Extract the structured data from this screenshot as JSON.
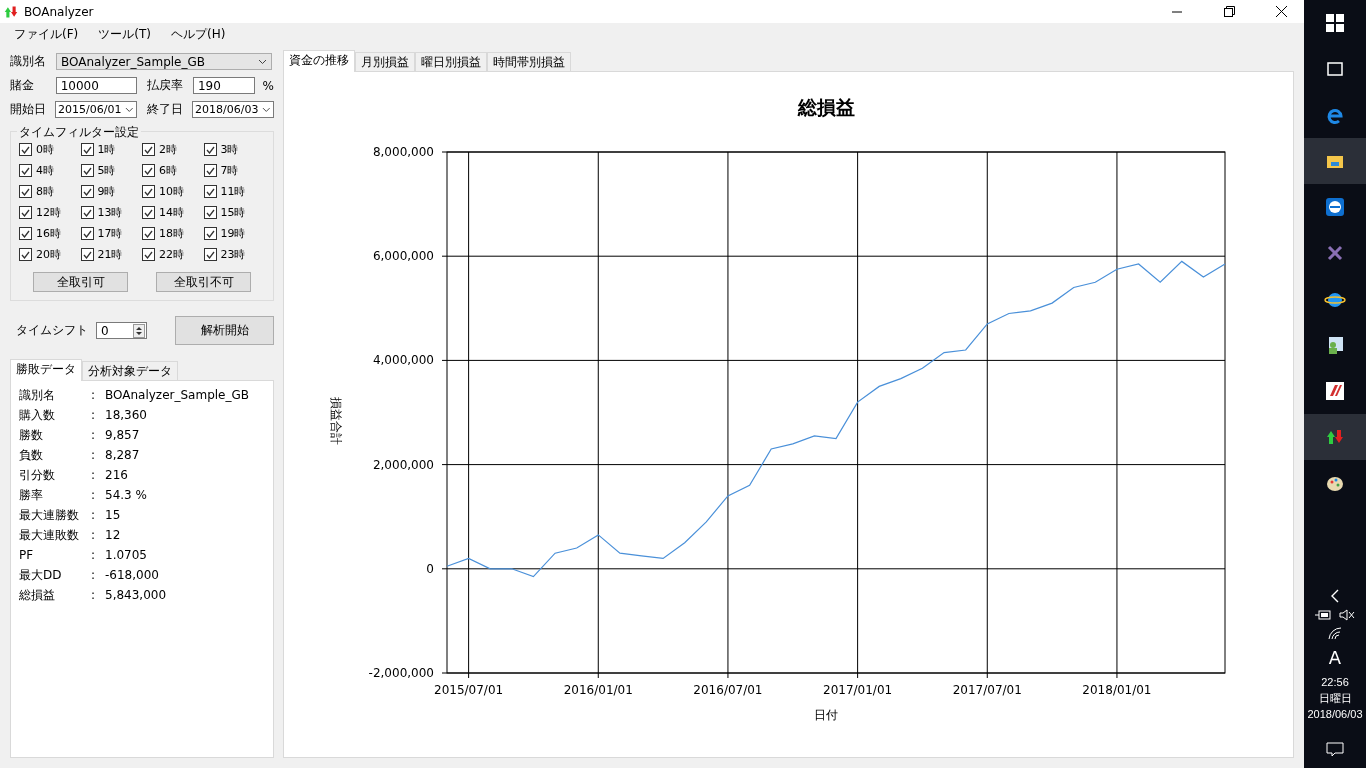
{
  "window": {
    "title": "BOAnalyzer"
  },
  "menu": [
    "ファイル(F)",
    "ツール(T)",
    "ヘルプ(H)"
  ],
  "settings": {
    "id_label": "識別名",
    "id_value": "BOAnalyzer_Sample_GB",
    "stake_label": "賭金",
    "stake_value": "10000",
    "payout_label": "払戻率",
    "payout_value": "190",
    "payout_unit": "%",
    "start_label": "開始日",
    "start_value": "2015/06/01",
    "end_label": "終了日",
    "end_value": "2018/06/03"
  },
  "time_filter": {
    "title": "タイムフィルター設定",
    "hours": [
      {
        "label": "0時",
        "checked": true
      },
      {
        "label": "1時",
        "checked": true
      },
      {
        "label": "2時",
        "checked": true
      },
      {
        "label": "3時",
        "checked": true
      },
      {
        "label": "4時",
        "checked": true
      },
      {
        "label": "5時",
        "checked": true
      },
      {
        "label": "6時",
        "checked": true
      },
      {
        "label": "7時",
        "checked": true
      },
      {
        "label": "8時",
        "checked": true
      },
      {
        "label": "9時",
        "checked": true
      },
      {
        "label": "10時",
        "checked": true
      },
      {
        "label": "11時",
        "checked": true
      },
      {
        "label": "12時",
        "checked": true
      },
      {
        "label": "13時",
        "checked": true
      },
      {
        "label": "14時",
        "checked": true
      },
      {
        "label": "15時",
        "checked": true
      },
      {
        "label": "16時",
        "checked": true
      },
      {
        "label": "17時",
        "checked": true
      },
      {
        "label": "18時",
        "checked": true
      },
      {
        "label": "19時",
        "checked": true
      },
      {
        "label": "20時",
        "checked": true
      },
      {
        "label": "21時",
        "checked": true
      },
      {
        "label": "22時",
        "checked": true
      },
      {
        "label": "23時",
        "checked": true
      }
    ],
    "buttons": [
      "全取引可",
      "全取引不可"
    ]
  },
  "time_shift": {
    "label": "タイムシフト",
    "value": "0"
  },
  "analyze_button": "解析開始",
  "result_tabs": [
    {
      "label": "勝敗データ",
      "selected": true
    },
    {
      "label": "分析対象データ",
      "selected": false
    }
  ],
  "results": [
    {
      "label": "識別名",
      "separator": ":",
      "value": "BOAnalyzer_Sample_GB"
    },
    {
      "label": "購入数",
      "separator": ":",
      "value": "18,360"
    },
    {
      "label": "勝数",
      "separator": ":",
      "value": "9,857"
    },
    {
      "label": "負数",
      "separator": ":",
      "value": "8,287"
    },
    {
      "label": "引分数",
      "separator": ":",
      "value": "216"
    },
    {
      "label": "勝率",
      "separator": ":",
      "value": "54.3 %"
    },
    {
      "label": "最大連勝数",
      "separator": ":",
      "value": "15"
    },
    {
      "label": "最大連敗数",
      "separator": ":",
      "value": "12"
    },
    {
      "label": "PF",
      "separator": ":",
      "value": "1.0705"
    },
    {
      "label": "最大DD",
      "separator": ":",
      "value": "-618,000"
    },
    {
      "label": "総損益",
      "separator": ":",
      "value": "5,843,000"
    }
  ],
  "chart_tabs": [
    {
      "label": "資金の推移",
      "selected": true
    },
    {
      "label": "月別損益",
      "selected": false
    },
    {
      "label": "曜日別損益",
      "selected": false
    },
    {
      "label": "時間帯別損益",
      "selected": false
    }
  ],
  "chart": {
    "chart_data": {
      "type": "line",
      "title": "総損益",
      "xlabel": "日付",
      "ylabel": "損益合計",
      "categories": [
        null,
        "2015/07/01",
        null,
        null,
        null,
        null,
        null,
        "2016/01/01",
        null,
        null,
        null,
        null,
        null,
        "2016/07/01",
        null,
        null,
        null,
        null,
        null,
        "2017/01/01",
        null,
        null,
        null,
        null,
        null,
        "2017/07/01",
        null,
        null,
        null,
        null,
        null,
        "2018/01/01",
        null,
        null,
        null,
        null,
        null
      ],
      "series": [
        {
          "color": "#4a90d9",
          "values": [
            50000,
            200000,
            0,
            0,
            -150000,
            300000,
            400000,
            650000,
            300000,
            250000,
            200000,
            500000,
            900000,
            1400000,
            1600000,
            2300000,
            2400000,
            2550000,
            2500000,
            3200000,
            3500000,
            3650000,
            3850000,
            4150000,
            4200000,
            4700000,
            4900000,
            4950000,
            5100000,
            5400000,
            5500000,
            5750000,
            5850000,
            5500000,
            5900000,
            5600000,
            5850000
          ]
        }
      ],
      "ylim": [
        -2000000,
        8000000
      ],
      "grid": true,
      "yticks": [
        {
          "value": -2000000,
          "label": "-2,000,000"
        },
        {
          "value": 0,
          "label": "0"
        },
        {
          "value": 2000000,
          "label": "2,000,000"
        },
        {
          "value": 4000000,
          "label": "4,000,000"
        },
        {
          "value": 6000000,
          "label": "6,000,000"
        },
        {
          "value": 8000000,
          "label": "8,000,000"
        }
      ]
    }
  },
  "taskbar": {
    "ime": "A",
    "time": "22:56",
    "weekday": "日曜日",
    "date": "2018/06/03"
  }
}
